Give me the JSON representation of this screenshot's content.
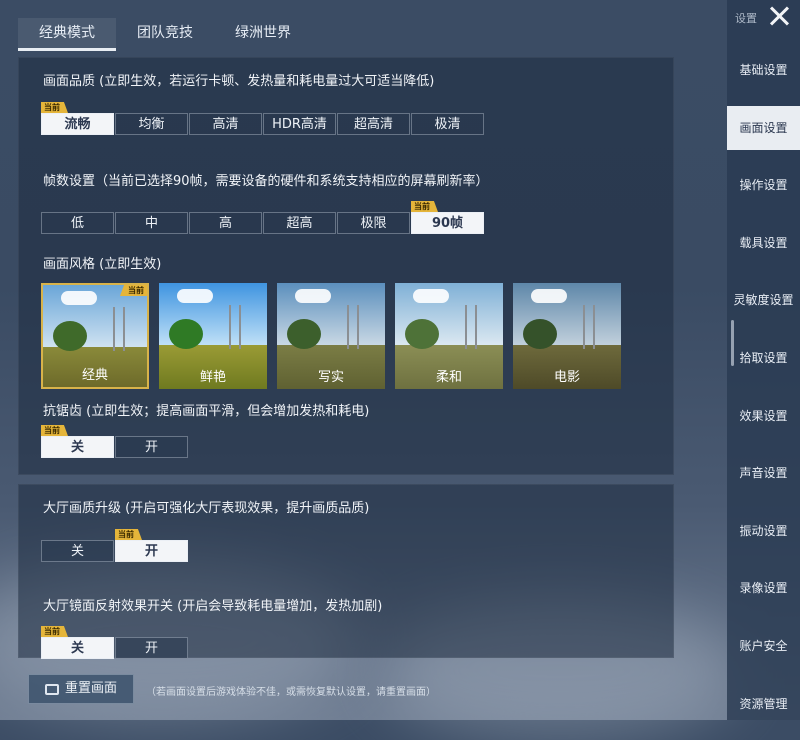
{
  "tabs": [
    "经典模式",
    "团队竞技",
    "绿洲世界"
  ],
  "badge_text": "当前",
  "quality": {
    "title": "画面品质 (立即生效，若运行卡顿、发热量和耗电量过大可适当降低)",
    "options": [
      "流畅",
      "均衡",
      "高清",
      "HDR高清",
      "超高清",
      "极清"
    ],
    "selected": "流畅"
  },
  "framerate": {
    "title": "帧数设置（当前已选择90帧，需要设备的硬件和系统支持相应的屏幕刷新率）",
    "options": [
      "低",
      "中",
      "高",
      "超高",
      "极限",
      "90帧"
    ],
    "selected": "90帧"
  },
  "style": {
    "title": "画面风格 (立即生效)",
    "options": [
      "经典",
      "鲜艳",
      "写实",
      "柔和",
      "电影"
    ],
    "selected": "经典"
  },
  "antialias": {
    "title": "抗锯齿 (立即生效；提高画面平滑，但会增加发热和耗电)",
    "options": [
      "关",
      "开"
    ],
    "selected": "关"
  },
  "lobby_quality": {
    "title": "大厅画质升级 (开启可强化大厅表现效果，提升画质品质)",
    "options": [
      "关",
      "开"
    ],
    "selected": "开"
  },
  "lobby_reflection": {
    "title": "大厅镜面反射效果开关 (开启会导致耗电量增加，发热加剧)",
    "options": [
      "关",
      "开"
    ],
    "selected": "关"
  },
  "reset": {
    "label": "重置画面",
    "note": "（若画面设置后游戏体验不佳，或需恢复默认设置，请重置画面）"
  },
  "sidebar": {
    "header": "设置",
    "items": [
      "基础设置",
      "画面设置",
      "操作设置",
      "载具设置",
      "灵敏度设置",
      "拾取设置",
      "效果设置",
      "声音设置",
      "振动设置",
      "录像设置",
      "账户安全",
      "资源管理"
    ],
    "active": "画面设置"
  },
  "colors": {
    "selected_bg": "#f3f5f8",
    "badge": "#e5b53a",
    "panel": "#2b3c55",
    "sidebar_active": "#e9edf2"
  }
}
